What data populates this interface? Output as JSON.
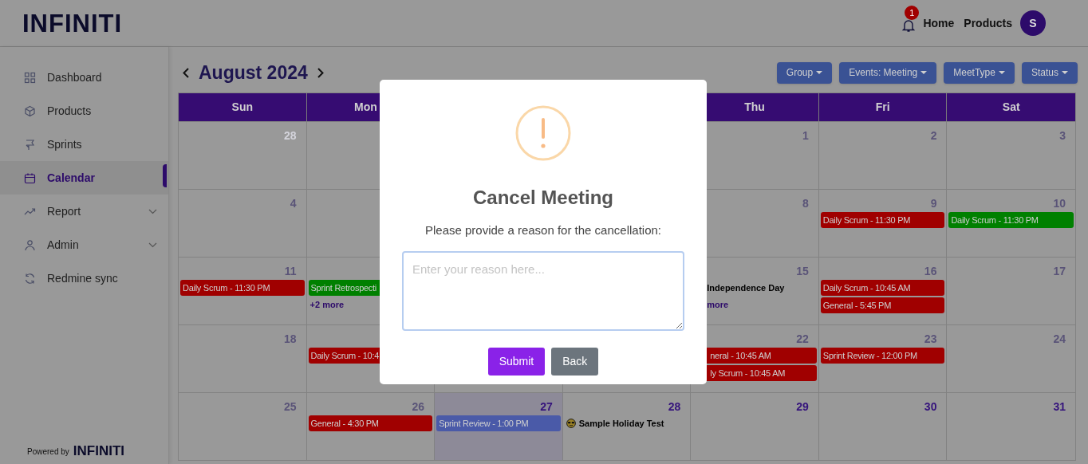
{
  "header": {
    "logo": "INFINITI",
    "notification_count": "1",
    "nav": [
      "Home",
      "Products"
    ],
    "avatar": "S"
  },
  "sidebar": {
    "items": [
      {
        "label": "Dashboard",
        "selected": false,
        "expandable": false
      },
      {
        "label": "Products",
        "selected": false,
        "expandable": false
      },
      {
        "label": "Sprints",
        "selected": false,
        "expandable": false
      },
      {
        "label": "Calendar",
        "selected": true,
        "expandable": false
      },
      {
        "label": "Report",
        "selected": false,
        "expandable": true
      },
      {
        "label": "Admin",
        "selected": false,
        "expandable": true
      },
      {
        "label": "Redmine sync",
        "selected": false,
        "expandable": false
      }
    ],
    "powered_by": "Powered by",
    "powered_logo": "INFINITI"
  },
  "calendar": {
    "title": "August 2024",
    "filters": [
      "Group",
      "Events: Meeting",
      "MeetType",
      "Status"
    ],
    "weekdays": {
      "sun": "Sun",
      "mon": "Mon",
      "thu": "Thu",
      "fri": "Fri",
      "sat": "Sat"
    },
    "weeks": [
      {
        "sun": {
          "day": "28",
          "in_month": false
        },
        "thu": {
          "day": "1",
          "in_month": true,
          "past": true,
          "today": false
        },
        "fri": {
          "day": "2",
          "in_month": true,
          "past": true,
          "today": false
        },
        "sat": {
          "day": "3",
          "in_month": true,
          "past": true,
          "today": false
        }
      },
      {
        "sun": {
          "day": "4",
          "in_month": true,
          "past": true,
          "today": false
        },
        "thu": {
          "day": "8",
          "in_month": true,
          "past": true,
          "today": false
        },
        "fri": {
          "day": "9",
          "in_month": true,
          "past": true,
          "today": false,
          "events": [
            {
              "kind": "bar",
              "text": "Daily Scrum - 11:30 PM",
              "color": "#a00000"
            }
          ]
        },
        "sat": {
          "day": "10",
          "in_month": true,
          "past": true,
          "today": false,
          "events": [
            {
              "kind": "bar",
              "text": "Daily Scrum - 11:30 PM",
              "color": "#008000"
            }
          ]
        }
      },
      {
        "sun": {
          "day": "11",
          "in_month": true,
          "past": true,
          "today": false,
          "events": [
            {
              "kind": "bar",
              "text": "Daily Scrum - 11:30 PM",
              "color": "#a00000"
            }
          ]
        },
        "mon": {
          "events": [
            {
              "kind": "bar",
              "text": "Sprint Retrospecti",
              "color": "#008000"
            },
            {
              "kind": "more",
              "text": "+2 more"
            }
          ]
        },
        "thu": {
          "day": "15",
          "in_month": true,
          "past": true,
          "today": false,
          "events": [
            {
              "kind": "holiday",
              "text": "Independence Day",
              "emoji": false
            },
            {
              "kind": "more",
              "text": "more"
            }
          ]
        },
        "fri": {
          "day": "16",
          "in_month": true,
          "past": true,
          "today": false,
          "events": [
            {
              "kind": "bar",
              "text": "Daily Scrum - 10:45 AM",
              "color": "#a00000"
            },
            {
              "kind": "bar",
              "text": "General - 5:45 PM",
              "color": "#a00000"
            }
          ]
        },
        "sat": {
          "day": "17",
          "in_month": true,
          "past": true,
          "today": false
        }
      },
      {
        "sun": {
          "day": "18",
          "in_month": true,
          "past": true,
          "today": false
        },
        "mon": {
          "events": [
            {
              "kind": "bar",
              "text": "Daily Scrum - 10:4",
              "color": "#a00000"
            }
          ]
        },
        "thu": {
          "day": "22",
          "in_month": true,
          "past": true,
          "today": false,
          "events": [
            {
              "kind": "bar",
              "text": "neral - 10:45 AM",
              "color": "#a00000"
            },
            {
              "kind": "bar",
              "text": "ly Scrum - 10:45 AM",
              "color": "#a00000"
            }
          ]
        },
        "fri": {
          "day": "23",
          "in_month": true,
          "past": true,
          "today": false,
          "events": [
            {
              "kind": "bar",
              "text": "Sprint Review - 12:00 PM",
              "color": "#a00000"
            }
          ]
        },
        "sat": {
          "day": "24",
          "in_month": true,
          "past": true,
          "today": false
        }
      },
      {
        "sun": {
          "day": "25",
          "in_month": true,
          "past": true,
          "today": false
        },
        "mon": {
          "day": "26",
          "in_month": true,
          "past": true,
          "today": false,
          "events": [
            {
              "kind": "bar",
              "text": "General - 4:30 PM",
              "color": "#a00000"
            }
          ]
        },
        "tue": {
          "day": "27",
          "in_month": true,
          "past": false,
          "today": true,
          "events": [
            {
              "kind": "bar",
              "text": "Sprint Review - 1:00 PM",
              "color": "#4a5aa8"
            }
          ]
        },
        "wed": {
          "day": "28",
          "in_month": true,
          "past": false,
          "today": false,
          "events": [
            {
              "kind": "holiday",
              "text": "Sample Holiday Test",
              "emoji": true
            }
          ]
        },
        "thu": {
          "day": "29",
          "in_month": true,
          "past": false,
          "today": false
        },
        "fri": {
          "day": "30",
          "in_month": true,
          "past": false,
          "today": false
        },
        "sat": {
          "day": "31",
          "in_month": true,
          "past": false,
          "today": false
        }
      }
    ]
  },
  "dialog": {
    "title": "Cancel Meeting",
    "message": "Please provide a reason for the cancellation:",
    "placeholder": "Enter your reason here...",
    "buttons": [
      {
        "label": "Submit",
        "kind": "primary"
      },
      {
        "label": "Back",
        "kind": "secondary"
      }
    ]
  }
}
